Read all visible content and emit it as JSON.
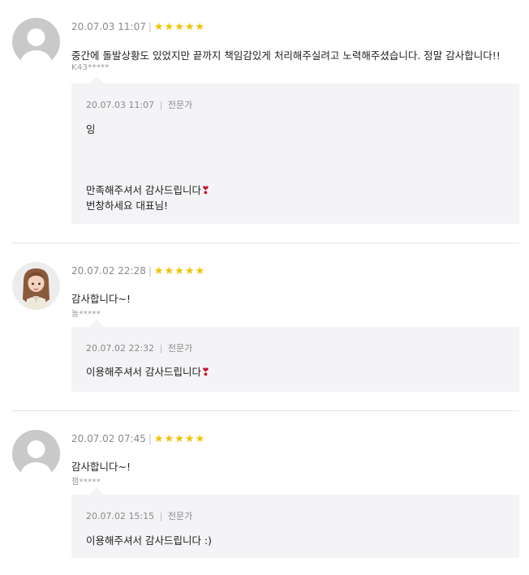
{
  "reviews": [
    {
      "avatar": "default-avatar",
      "date": "20.07.03 11:07",
      "rating": 5,
      "text": "중간에 돌발상황도 있었지만 끝까지 책임감있게 처리해주실려고 노력해주셨습니다. 정말 감사합니다!!",
      "user": "K43*****",
      "reply": {
        "date": "20.07.03 11:07",
        "role": "전문가",
        "lines": [
          "잉",
          "",
          "",
          "만족해주셔서 감사드립니다",
          "번창하세요 대표님!"
        ]
      }
    },
    {
      "avatar": "character-avatar",
      "date": "20.07.02 22:28",
      "rating": 5,
      "text": "감사합니다~!",
      "user": "놀*****",
      "reply": {
        "date": "20.07.02 22:32",
        "role": "전문가",
        "lines": [
          "이용해주셔서 감사드립니다"
        ]
      }
    },
    {
      "avatar": "default-avatar",
      "date": "20.07.02 07:45",
      "rating": 5,
      "text": "감사합니다~!",
      "user": "잼*****",
      "reply": {
        "date": "20.07.02 15:15",
        "role": "전문가",
        "lines": [
          "이용해주셔서 감사드립니다 :)"
        ]
      }
    }
  ],
  "separator": "|",
  "star_glyph": "★",
  "heart_glyph": "❣",
  "colors": {
    "star": "#f2c200",
    "reply_bg": "#f4f4f7",
    "heart": "#c8102e",
    "meta": "#8a8a8a"
  }
}
